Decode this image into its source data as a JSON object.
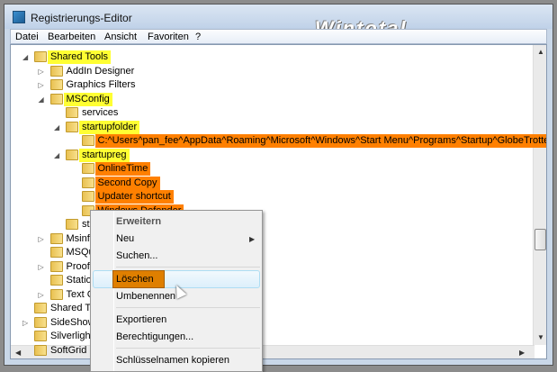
{
  "window": {
    "title": "Registrierungs-Editor",
    "watermark": "Wintotal"
  },
  "menubar": [
    "Datei",
    "Bearbeiten",
    "Ansicht",
    "Favoriten",
    "?"
  ],
  "tree": [
    {
      "label": "Shared Tools",
      "level": 0,
      "state": "expanded",
      "highlight": "yellow"
    },
    {
      "label": "AddIn Designer",
      "level": 1,
      "state": "collapsed"
    },
    {
      "label": "Graphics Filters",
      "level": 1,
      "state": "collapsed"
    },
    {
      "label": "MSConfig",
      "level": 1,
      "state": "expanded",
      "highlight": "yellow"
    },
    {
      "label": "services",
      "level": 2,
      "state": "leaf"
    },
    {
      "label": "startupfolder",
      "level": 2,
      "state": "expanded",
      "highlight": "yellow"
    },
    {
      "label": "C:^Users^pan_fee^AppData^Roaming^Microsoft^Windows^Start Menu^Programs^Startup^GlobeTrotter",
      "level": 3,
      "state": "leaf",
      "highlight": "orange"
    },
    {
      "label": "startupreg",
      "level": 2,
      "state": "expanded",
      "highlight": "yellow"
    },
    {
      "label": "OnlineTime",
      "level": 3,
      "state": "leaf",
      "highlight": "orange"
    },
    {
      "label": "Second Copy",
      "level": 3,
      "state": "leaf",
      "highlight": "orange"
    },
    {
      "label": "Updater shortcut",
      "level": 3,
      "state": "leaf",
      "highlight": "orange"
    },
    {
      "label": "Windows Defender",
      "level": 3,
      "state": "leaf",
      "highlight": "orange"
    },
    {
      "label": "sta",
      "level": 2,
      "state": "leaf"
    },
    {
      "label": "Msinfo",
      "level": 1,
      "state": "collapsed"
    },
    {
      "label": "MSQu",
      "level": 1,
      "state": "leaf"
    },
    {
      "label": "Proofi",
      "level": 1,
      "state": "collapsed"
    },
    {
      "label": "Station",
      "level": 1,
      "state": "leaf"
    },
    {
      "label": "Text C",
      "level": 1,
      "state": "collapsed"
    },
    {
      "label": "Shared To",
      "level": 0,
      "state": "leaf"
    },
    {
      "label": "SideShow",
      "level": 0,
      "state": "collapsed"
    },
    {
      "label": "Silverlight",
      "level": 0,
      "state": "leaf"
    },
    {
      "label": "SoftGrid",
      "level": 0,
      "state": "leaf"
    }
  ],
  "context_menu": {
    "items": [
      "Erweitern",
      "Neu",
      "Suchen...",
      "Löschen",
      "Umbenennen",
      "Exportieren",
      "Berechtigungen...",
      "Schlüsselnamen kopieren"
    ]
  },
  "colors": {
    "yellow": "#ffff33",
    "orange": "#ff8000",
    "selected": "#df7f00"
  }
}
